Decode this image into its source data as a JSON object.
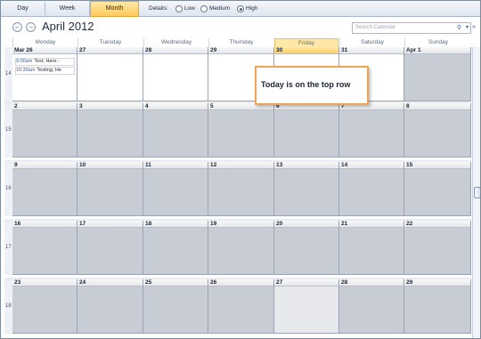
{
  "toolbar": {
    "views": [
      {
        "label": "Day",
        "active": false
      },
      {
        "label": "Week",
        "active": false
      },
      {
        "label": "Month",
        "active": true
      }
    ],
    "details_label": "Details:",
    "details_options": [
      {
        "label": "Low",
        "selected": false
      },
      {
        "label": "Medium",
        "selected": false
      },
      {
        "label": "High",
        "selected": true
      }
    ]
  },
  "header": {
    "prev_icon": "arrow-left-icon",
    "next_icon": "arrow-right-icon",
    "title": "April 2012",
    "search_placeholder": "Search Calendar",
    "search_icon": "search-icon",
    "collapse_icon": "double-chevron-icon"
  },
  "weekdays": [
    "Monday",
    "Tuesday",
    "Wednesday",
    "Thursday",
    "Friday",
    "Saturday",
    "Sunday"
  ],
  "today_index": 4,
  "weeks": [
    {
      "week": "14",
      "days": [
        "Mar 26",
        "27",
        "28",
        "29",
        "30",
        "31",
        "Apr 1"
      ]
    },
    {
      "week": "15",
      "days": [
        "2",
        "3",
        "4",
        "5",
        "6",
        "7",
        "8"
      ]
    },
    {
      "week": "16",
      "days": [
        "9",
        "10",
        "11",
        "12",
        "13",
        "14",
        "15"
      ]
    },
    {
      "week": "17",
      "days": [
        "16",
        "17",
        "18",
        "19",
        "20",
        "21",
        "22"
      ]
    },
    {
      "week": "18",
      "days": [
        "23",
        "24",
        "25",
        "26",
        "27",
        "28",
        "29"
      ]
    }
  ],
  "appointments": [
    {
      "time": "9:00am",
      "subject": "Test; Here; ·"
    },
    {
      "time": "10:30am",
      "subject": "Testing; He"
    }
  ],
  "callout": {
    "text": "Today is on the top row"
  },
  "colors": {
    "accent": "#ffc95a",
    "callout_border": "#f0a451",
    "cell_gray": "#c8ccd5"
  }
}
